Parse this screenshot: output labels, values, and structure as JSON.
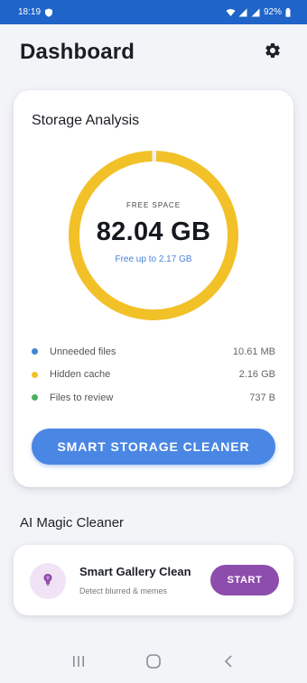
{
  "status_bar": {
    "time": "18:19",
    "battery": "92%",
    "background_color": "#1f64c8"
  },
  "header": {
    "title": "Dashboard",
    "settings_icon": "gear-icon"
  },
  "storage_card": {
    "title": "Storage Analysis",
    "free_space_label": "FREE SPACE",
    "free_space_value": "82.04 GB",
    "free_up_text": "Free up to 2.17 GB",
    "ring_color": "#f2c128",
    "legend": [
      {
        "label": "Unneeded files",
        "value": "10.61 MB",
        "color": "#3d86d8"
      },
      {
        "label": "Hidden cache",
        "value": "2.16 GB",
        "color": "#f2c128"
      },
      {
        "label": "Files to review",
        "value": "737 B",
        "color": "#4caf61"
      }
    ],
    "clean_button_label": "SMART STORAGE CLEANER",
    "clean_button_color": "#4a86e4"
  },
  "ai_section": {
    "title": "AI Magic Cleaner",
    "card": {
      "icon": "brain-icon",
      "title": "Smart Gallery Clean",
      "subtitle": "Detect blurred & memes",
      "start_label": "START",
      "start_color": "#8d4dac"
    }
  },
  "nav_bar": {
    "items": [
      "recent-apps-icon",
      "home-icon",
      "back-icon"
    ]
  }
}
